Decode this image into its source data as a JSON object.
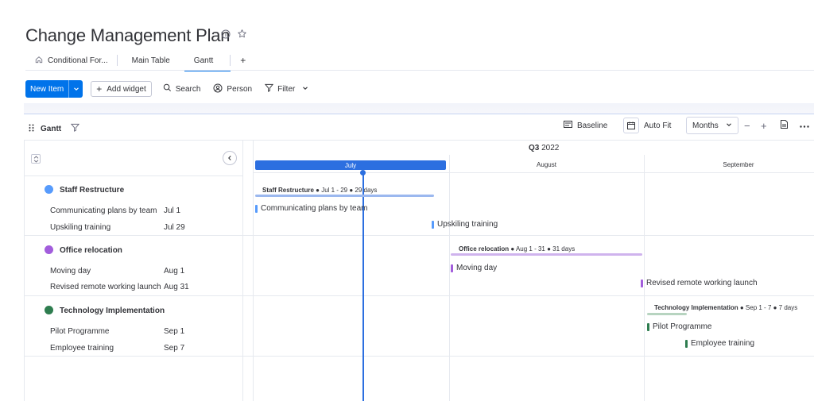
{
  "board": {
    "title": "Change Management Plan"
  },
  "tabs": [
    {
      "label": "Conditional For..."
    },
    {
      "label": "Main Table"
    },
    {
      "label": "Gantt"
    }
  ],
  "toolbar": {
    "new_item": "New Item",
    "add_widget": "Add widget",
    "search": "Search",
    "person": "Person",
    "filter": "Filter"
  },
  "gantt": {
    "title": "Gantt",
    "baseline": "Baseline",
    "auto_fit": "Auto Fit",
    "zoom": "Months",
    "quarter_label": "Q3",
    "quarter_year": "2022",
    "months": [
      "July",
      "August",
      "September"
    ]
  },
  "groups": [
    {
      "name": "Staff Restructure",
      "color": "#579bfc",
      "summary_dates": "Jul 1 - 29",
      "summary_days": "29 days",
      "items": [
        {
          "name": "Communicating plans by team",
          "date": "Jul 1"
        },
        {
          "name": "Upskiling training",
          "date": "Jul 29"
        }
      ]
    },
    {
      "name": "Office relocation",
      "color": "#a25ddc",
      "summary_dates": "Aug 1 - 31",
      "summary_days": "31 days",
      "items": [
        {
          "name": "Moving day",
          "date": "Aug 1"
        },
        {
          "name": "Revised remote working launch",
          "date": "Aug 31"
        }
      ]
    },
    {
      "name": "Technology Implementation",
      "color": "#2e7d4f",
      "summary_dates": "Sep 1 - 7",
      "summary_days": "7 days",
      "items": [
        {
          "name": "Pilot Programme",
          "date": "Sep 1"
        },
        {
          "name": "Employee training",
          "date": "Sep 7"
        }
      ]
    }
  ],
  "icons": {
    "title_info": "info-icon",
    "title_star": "star-icon",
    "tab_home": "home-icon",
    "add_tab": "plus-icon",
    "new_item_caret": "chevron-down-icon",
    "add_widget": "plus-icon",
    "search": "search-icon",
    "person": "person-icon",
    "filter": "filter-icon",
    "gantt_drag": "drag-handle-icon",
    "gantt_filter": "filter-icon",
    "baseline": "baseline-icon",
    "auto_fit": "calendar-fit-icon",
    "zoom_out": "minus-icon",
    "zoom_in": "plus-icon",
    "export": "file-icon",
    "more": "more-icon",
    "collapse_all": "collapse-icon",
    "toggle_left_pane": "chevron-left-icon"
  }
}
